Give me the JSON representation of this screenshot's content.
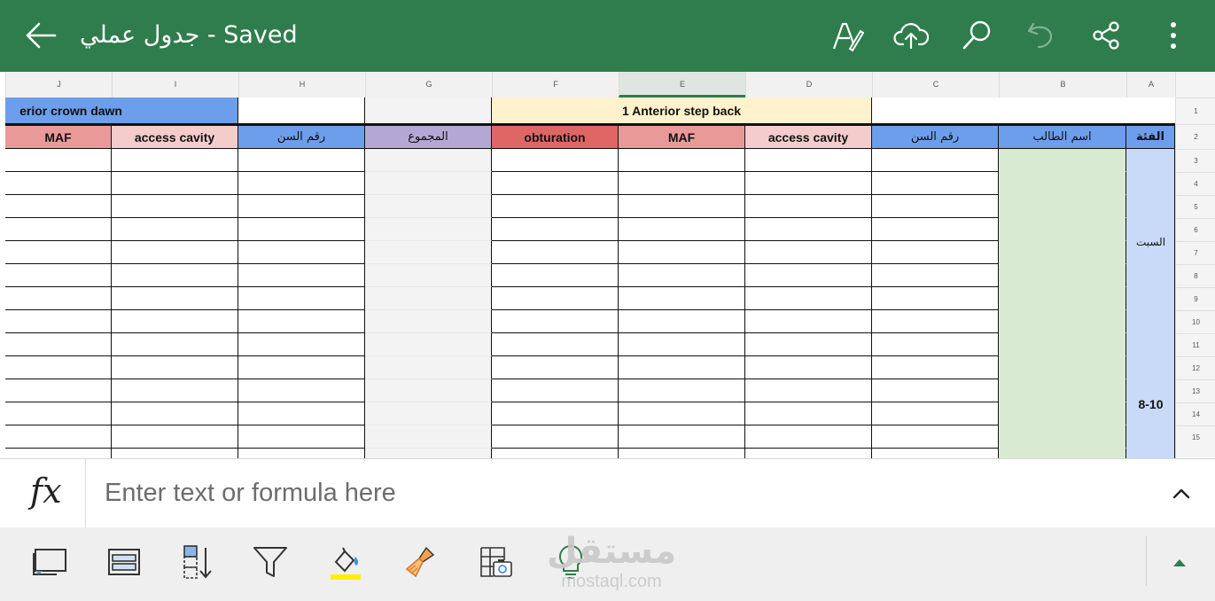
{
  "app": {
    "title": "جدول عملي  - Saved",
    "accent": "#2f7d4c"
  },
  "header_icons": [
    "back-arrow-icon",
    "draw-pen-icon",
    "cloud-upload-icon",
    "search-icon",
    "undo-icon",
    "share-icon",
    "more-icon"
  ],
  "columns": [
    "J",
    "I",
    "H",
    "G",
    "F",
    "E",
    "D",
    "C",
    "B",
    "A"
  ],
  "selected_column": "E",
  "row_numbers": [
    "1",
    "2",
    "3",
    "4",
    "5",
    "6",
    "7",
    "8",
    "9",
    "10",
    "11",
    "12",
    "13",
    "14",
    "15"
  ],
  "group_headers": {
    "left": "erior crown dawn",
    "right": "1 Anterior step back"
  },
  "field_headers": {
    "J": "MAF",
    "I": "access cavity",
    "H": "رقم السن",
    "G": "المجموع",
    "F": "obturation",
    "E": "MAF",
    "D": "access cavity",
    "C": "رقم السن",
    "B": "اسم الطالب",
    "A": "الفئة"
  },
  "column_a_values": {
    "day": "السبت",
    "time": "8-10"
  },
  "colors": {
    "blue_header": "#6d9eeb",
    "light_yellow": "#fff2cc",
    "pink": "#f4cccc",
    "salmon": "#ea9999",
    "red": "#e06666",
    "purple": "#b4a7d6",
    "light_green": "#d9ead3",
    "light_blue": "#c9daf8",
    "gray": "#f3f3f3"
  },
  "formula_bar": {
    "placeholder": "Enter text or formula here"
  },
  "bottom_tools": [
    "freeze-panes-icon",
    "row-layout-icon",
    "sort-icon",
    "filter-icon",
    "fill-color-icon",
    "clear-format-icon",
    "insert-picture-icon",
    "ideas-icon"
  ],
  "watermark": {
    "arabic": "مستقل",
    "latin": "mostaql.com"
  }
}
